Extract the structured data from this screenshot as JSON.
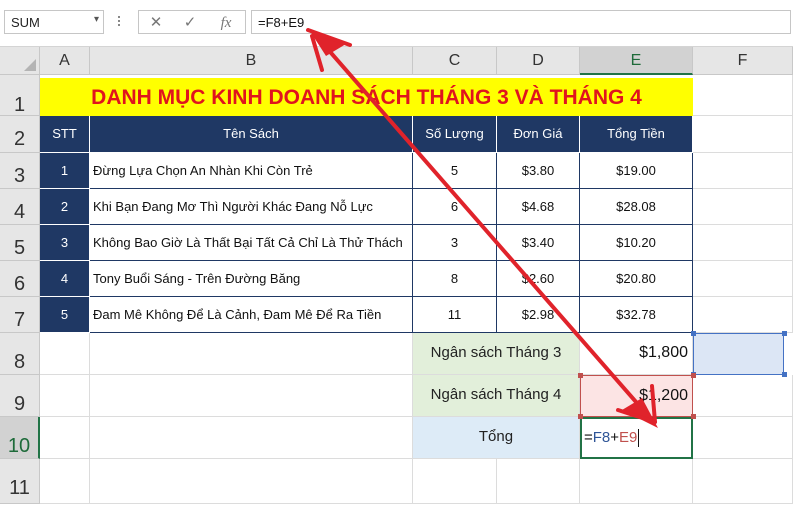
{
  "formula_bar": {
    "name_box": "SUM",
    "name_box_arrow": "▾",
    "cancel_icon": "✕",
    "enter_icon": "✓",
    "fx_label": "fx",
    "formula": "=F8+E9"
  },
  "columns": [
    "A",
    "B",
    "C",
    "D",
    "E",
    "F"
  ],
  "rows": [
    "1",
    "2",
    "3",
    "4",
    "5",
    "6",
    "7",
    "8",
    "9",
    "10",
    "11"
  ],
  "sheet": {
    "title": "DANH MỤC KINH DOANH SÁCH THÁNG 3 VÀ THÁNG 4",
    "headers": {
      "stt": "STT",
      "ten_sach": "Tên Sách",
      "so_luong": "Số Lượng",
      "don_gia": "Đơn Giá",
      "tong_tien": "Tổng Tiền"
    },
    "books": [
      {
        "stt": "1",
        "name": "Đừng Lựa Chọn An Nhàn Khi Còn Trẻ",
        "qty": "5",
        "price": "$3.80",
        "total": "$19.00"
      },
      {
        "stt": "2",
        "name": "Khi Bạn Đang Mơ Thì Người Khác Đang Nỗ Lực",
        "qty": "6",
        "price": "$4.68",
        "total": "$28.08"
      },
      {
        "stt": "3",
        "name": "Không Bao Giờ Là Thất Bại Tất Cả Chỉ Là Thử Thách",
        "qty": "3",
        "price": "$3.40",
        "total": "$10.20"
      },
      {
        "stt": "4",
        "name": "Tony Buổi Sáng - Trên Đường Băng",
        "qty": "8",
        "price": "$2.60",
        "total": "$20.80"
      },
      {
        "stt": "5",
        "name": "Đam Mê Không Để Là Cảnh, Đam Mê Để Ra Tiền",
        "qty": "11",
        "price": "$2.98",
        "total": "$32.78"
      }
    ],
    "budget_march_label": "Ngân sách Tháng 3",
    "budget_march_value": "$1,800",
    "budget_april_label": "Ngân sách Tháng 4",
    "budget_april_value": "$1,200",
    "total_label": "Tổng",
    "edit_formula": {
      "eq": "=",
      "ref1": "F8",
      "plus": "+",
      "ref2": "E9"
    }
  },
  "colors": {
    "title_bg": "#ffff00",
    "title_text": "#e0141e",
    "header_bg": "#1f3864",
    "green_label_bg": "#e2efda",
    "blue_label_bg": "#ddebf7",
    "arrow": "#e0232b",
    "excel_green": "#217346"
  }
}
